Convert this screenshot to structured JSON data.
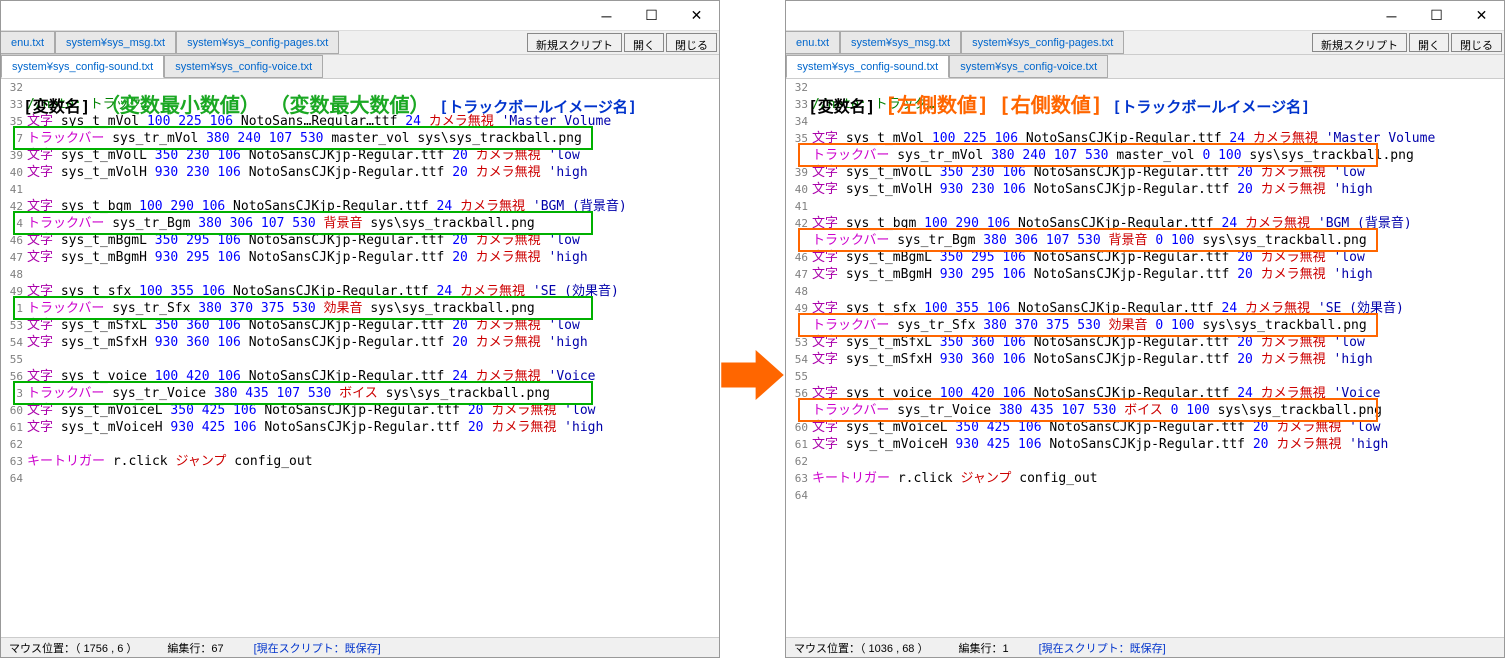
{
  "titlebar": {
    "min": "─",
    "max": "☐",
    "close": "✕"
  },
  "tabs_row1": [
    {
      "label": "enu.txt",
      "partial": true
    },
    {
      "label": "system¥sys_msg.txt",
      "partial": false
    },
    {
      "label": "system¥sys_config-pages.txt",
      "partial": false
    }
  ],
  "tabs_row2": [
    {
      "label": "system¥sys_config-sound.txt",
      "active": true
    },
    {
      "label": "system¥sys_config-voice.txt",
      "active": false
    }
  ],
  "actions": {
    "new_script": "新規スクリプト",
    "open": "開く",
    "close": "閉じる"
  },
  "annotations_left": {
    "var_name": "[変数名]",
    "min_val": "（変数最小数値）",
    "max_val": "（変数最大数値）",
    "trackball": "[トラックボールイメージ名]"
  },
  "annotations_right": {
    "var_name": "[変数名]",
    "left_val": "[左側数値]",
    "right_val": "[右側数値]",
    "trackball": "[トラックボールイメージ名]"
  },
  "lines_left": [
    {
      "no": "32",
      "html": ""
    },
    {
      "no": "33",
      "html": "<span class='c-comment'>//note: トラック…</span>"
    },
    {
      "no": "35",
      "html": "<span class='c-keyword2'>文字</span> <span class='c-black'>sys_t_mVol</span> <span class='c-number'>100 225 106</span>  <span class='c-black'>NotoSans…Regular…ttf</span> <span class='c-number'>24</span> <span class='c-red'>カメラ無視</span> <span class='c-string'>'Master Volume</span>"
    },
    {
      "no": "",
      "html": ""
    },
    {
      "no": "7",
      "html": "<span class='c-keyword'>トラックバー</span> <span class='c-black'>sys_tr_mVol</span> <span class='c-number'>380 240 107 530</span> <span class='c-black'>master_vol sys\\sys_trackball.png</span>",
      "box": "green"
    },
    {
      "no": "",
      "html": ""
    },
    {
      "no": "39",
      "html": "<span class='c-keyword2'>文字</span> <span class='c-black'>sys_t_mVolL</span> <span class='c-number'>350 230 106</span>  <span class='c-black'>NotoSansCJKjp-Regular.ttf</span> <span class='c-number'>20</span> <span class='c-red'>カメラ無視</span> <span class='c-string'>'low</span>"
    },
    {
      "no": "40",
      "html": "<span class='c-keyword2'>文字</span> <span class='c-black'>sys_t_mVolH</span> <span class='c-number'>930 230 106</span>  <span class='c-black'>NotoSansCJKjp-Regular.ttf</span> <span class='c-number'>20</span> <span class='c-red'>カメラ無視</span> <span class='c-string'>'high</span>"
    },
    {
      "no": "41",
      "html": ""
    },
    {
      "no": "42",
      "html": "<span class='c-keyword2'>文字</span> <span class='c-black'>sys_t_bgm</span> <span class='c-number'>100 290 106</span>  <span class='c-black'>NotoSansCJKjp-Regular.ttf</span> <span class='c-number'>24</span> <span class='c-red'>カメラ無視</span> <span class='c-string'>'BGM (背景音)</span>"
    },
    {
      "no": "",
      "html": ""
    },
    {
      "no": "4",
      "html": "<span class='c-keyword'>トラックバー</span> <span class='c-black'>sys_tr_Bgm</span> <span class='c-number'>380 306 107 530</span> <span class='c-red'>背景音</span> <span class='c-black'>sys\\sys_trackball.png</span>",
      "box": "green"
    },
    {
      "no": "",
      "html": ""
    },
    {
      "no": "46",
      "html": "<span class='c-keyword2'>文字</span> <span class='c-black'>sys_t_mBgmL</span> <span class='c-number'>350 295 106</span>  <span class='c-black'>NotoSansCJKjp-Regular.ttf</span> <span class='c-number'>20</span> <span class='c-red'>カメラ無視</span> <span class='c-string'>'low</span>"
    },
    {
      "no": "47",
      "html": "<span class='c-keyword2'>文字</span> <span class='c-black'>sys_t_mBgmH</span> <span class='c-number'>930 295 106</span>  <span class='c-black'>NotoSansCJKjp-Regular.ttf</span> <span class='c-number'>20</span> <span class='c-red'>カメラ無視</span> <span class='c-string'>'high</span>"
    },
    {
      "no": "48",
      "html": ""
    },
    {
      "no": "49",
      "html": "<span class='c-keyword2'>文字</span> <span class='c-black'>sys_t_sfx</span> <span class='c-number'>100 355 106</span>  <span class='c-black'>NotoSansCJKjp-Regular.ttf</span> <span class='c-number'>24</span> <span class='c-red'>カメラ無視</span> <span class='c-string'>'SE (効果音)</span>"
    },
    {
      "no": "",
      "html": ""
    },
    {
      "no": "1",
      "html": "<span class='c-keyword'>トラックバー</span> <span class='c-black'>sys_tr_Sfx</span> <span class='c-number'>380 370 375 530</span> <span class='c-red'>効果音</span> <span class='c-black'>sys\\sys_trackball.png</span>",
      "box": "green"
    },
    {
      "no": "",
      "html": ""
    },
    {
      "no": "53",
      "html": "<span class='c-keyword2'>文字</span> <span class='c-black'>sys_t_mSfxL</span> <span class='c-number'>350 360 106</span>  <span class='c-black'>NotoSansCJKjp-Regular.ttf</span> <span class='c-number'>20</span> <span class='c-red'>カメラ無視</span> <span class='c-string'>'low</span>"
    },
    {
      "no": "54",
      "html": "<span class='c-keyword2'>文字</span> <span class='c-black'>sys_t_mSfxH</span> <span class='c-number'>930 360 106</span>  <span class='c-black'>NotoSansCJKjp-Regular.ttf</span> <span class='c-number'>20</span> <span class='c-red'>カメラ無視</span> <span class='c-string'>'high</span>"
    },
    {
      "no": "55",
      "html": ""
    },
    {
      "no": "56",
      "html": "<span class='c-keyword2'>文字</span> <span class='c-black'>sys_t_voice</span> <span class='c-number'>100 420 106</span>  <span class='c-black'>NotoSansCJKjp-Regular.ttf</span> <span class='c-number'>24</span> <span class='c-red'>カメラ無視</span> <span class='c-string'>'Voice</span>"
    },
    {
      "no": "",
      "html": ""
    },
    {
      "no": "3",
      "html": "<span class='c-keyword'>トラックバー</span> <span class='c-black'>sys_tr_Voice</span> <span class='c-number'>380 435 107 530</span> <span class='c-red'>ボイス</span> <span class='c-black'>sys\\sys_trackball.png</span>",
      "box": "green"
    },
    {
      "no": "",
      "html": ""
    },
    {
      "no": "60",
      "html": "<span class='c-keyword2'>文字</span> <span class='c-black'>sys_t_mVoiceL</span> <span class='c-number'>350 425 106</span>  <span class='c-black'>NotoSansCJKjp-Regular.ttf</span> <span class='c-number'>20</span> <span class='c-red'>カメラ無視</span> <span class='c-string'>'low</span>"
    },
    {
      "no": "61",
      "html": "<span class='c-keyword2'>文字</span> <span class='c-black'>sys_t_mVoiceH</span> <span class='c-number'>930 425 106</span>  <span class='c-black'>NotoSansCJKjp-Regular.ttf</span> <span class='c-number'>20</span> <span class='c-red'>カメラ無視</span> <span class='c-string'>'high</span>"
    },
    {
      "no": "62",
      "html": ""
    },
    {
      "no": "63",
      "html": "<span class='c-keyword'>キートリガー</span> <span class='c-black'>r.click</span> <span class='c-red'>ジャンプ</span> <span class='c-black'>config_out</span>"
    },
    {
      "no": "64",
      "html": ""
    }
  ],
  "lines_right": [
    {
      "no": "32",
      "html": ""
    },
    {
      "no": "33",
      "html": "<span class='c-comment'>//note: トラック…</span>"
    },
    {
      "no": "34",
      "html": ""
    },
    {
      "no": "35",
      "html": "<span class='c-keyword2'>文字</span> <span class='c-black'>sys_t_mVol</span> <span class='c-number'>100 225 106</span>  <span class='c-black'>NotoSansCJKjp-Regular.ttf</span> <span class='c-number'>24</span> <span class='c-red'>カメラ無視</span> <span class='c-string'>'Master Volume</span>"
    },
    {
      "no": "",
      "html": ""
    },
    {
      "no": "",
      "html": "<span class='c-keyword'>トラックバー</span> <span class='c-black'>sys_tr_mVol</span> <span class='c-number'>380 240 107 530</span> <span class='c-black'>master_vol</span> <span class='c-number'>0 100</span> <span class='c-black'>sys\\sys_trackball.png</span>",
      "box": "orange"
    },
    {
      "no": "",
      "html": ""
    },
    {
      "no": "39",
      "html": "<span class='c-keyword2'>文字</span> <span class='c-black'>sys_t_mVolL</span> <span class='c-number'>350 230 106</span>  <span class='c-black'>NotoSansCJKjp-Regular.ttf</span> <span class='c-number'>20</span> <span class='c-red'>カメラ無視</span> <span class='c-string'>'low</span>"
    },
    {
      "no": "40",
      "html": "<span class='c-keyword2'>文字</span> <span class='c-black'>sys_t_mVolH</span> <span class='c-number'>930 230 106</span>  <span class='c-black'>NotoSansCJKjp-Regular.ttf</span> <span class='c-number'>20</span> <span class='c-red'>カメラ無視</span> <span class='c-string'>'high</span>"
    },
    {
      "no": "41",
      "html": ""
    },
    {
      "no": "42",
      "html": "<span class='c-keyword2'>文字</span> <span class='c-black'>sys_t_bgm</span> <span class='c-number'>100 290 106</span>  <span class='c-black'>NotoSansCJKjp-Regular.ttf</span> <span class='c-number'>24</span> <span class='c-red'>カメラ無視</span> <span class='c-string'>'BGM (背景音)</span>"
    },
    {
      "no": "",
      "html": ""
    },
    {
      "no": "",
      "html": "<span class='c-keyword'>トラックバー</span> <span class='c-black'>sys_tr_Bgm</span> <span class='c-number'>380 306 107 530</span> <span class='c-red'>背景音</span> <span class='c-number'>0 100</span> <span class='c-black'>sys\\sys_trackball.png</span>",
      "box": "orange"
    },
    {
      "no": "",
      "html": ""
    },
    {
      "no": "46",
      "html": "<span class='c-keyword2'>文字</span> <span class='c-black'>sys_t_mBgmL</span> <span class='c-number'>350 295 106</span>  <span class='c-black'>NotoSansCJKjp-Regular.ttf</span> <span class='c-number'>20</span> <span class='c-red'>カメラ無視</span> <span class='c-string'>'low</span>"
    },
    {
      "no": "47",
      "html": "<span class='c-keyword2'>文字</span> <span class='c-black'>sys_t_mBgmH</span> <span class='c-number'>930 295 106</span>  <span class='c-black'>NotoSansCJKjp-Regular.ttf</span> <span class='c-number'>20</span> <span class='c-red'>カメラ無視</span> <span class='c-string'>'high</span>"
    },
    {
      "no": "48",
      "html": ""
    },
    {
      "no": "49",
      "html": "<span class='c-keyword2'>文字</span> <span class='c-black'>sys_t_sfx</span> <span class='c-number'>100 355 106</span>  <span class='c-black'>NotoSansCJKjp-Regular.ttf</span> <span class='c-number'>24</span> <span class='c-red'>カメラ無視</span> <span class='c-string'>'SE (効果音)</span>"
    },
    {
      "no": "",
      "html": ""
    },
    {
      "no": "",
      "html": "<span class='c-keyword'>トラックバー</span> <span class='c-black'>sys_tr_Sfx</span> <span class='c-number'>380 370 375 530</span> <span class='c-red'>効果音</span> <span class='c-number'>0 100</span> <span class='c-black'>sys\\sys_trackball.png</span>",
      "box": "orange"
    },
    {
      "no": "",
      "html": ""
    },
    {
      "no": "53",
      "html": "<span class='c-keyword2'>文字</span> <span class='c-black'>sys_t_mSfxL</span> <span class='c-number'>350 360 106</span>  <span class='c-black'>NotoSansCJKjp-Regular.ttf</span> <span class='c-number'>20</span> <span class='c-red'>カメラ無視</span> <span class='c-string'>'low</span>"
    },
    {
      "no": "54",
      "html": "<span class='c-keyword2'>文字</span> <span class='c-black'>sys_t_mSfxH</span> <span class='c-number'>930 360 106</span>  <span class='c-black'>NotoSansCJKjp-Regular.ttf</span> <span class='c-number'>20</span> <span class='c-red'>カメラ無視</span> <span class='c-string'>'high</span>"
    },
    {
      "no": "55",
      "html": ""
    },
    {
      "no": "56",
      "html": "<span class='c-keyword2'>文字</span> <span class='c-black'>sys_t_voice</span> <span class='c-number'>100 420 106</span>  <span class='c-black'>NotoSansCJKjp-Regular.ttf</span> <span class='c-number'>24</span> <span class='c-red'>カメラ無視</span> <span class='c-string'>'Voice</span>"
    },
    {
      "no": "",
      "html": ""
    },
    {
      "no": "",
      "html": "<span class='c-keyword'>トラックバー</span> <span class='c-black'>sys_tr_Voice</span> <span class='c-number'>380 435 107 530</span> <span class='c-red'>ボイス</span> <span class='c-number'>0 100</span> <span class='c-black'>sys\\sys_trackball.png</span>",
      "box": "orange"
    },
    {
      "no": "",
      "html": ""
    },
    {
      "no": "60",
      "html": "<span class='c-keyword2'>文字</span> <span class='c-black'>sys_t_mVoiceL</span> <span class='c-number'>350 425 106</span>  <span class='c-black'>NotoSansCJKjp-Regular.ttf</span> <span class='c-number'>20</span> <span class='c-red'>カメラ無視</span> <span class='c-string'>'low</span>"
    },
    {
      "no": "61",
      "html": "<span class='c-keyword2'>文字</span> <span class='c-black'>sys_t_mVoiceH</span> <span class='c-number'>930 425 106</span>  <span class='c-black'>NotoSansCJKjp-Regular.ttf</span> <span class='c-number'>20</span> <span class='c-red'>カメラ無視</span> <span class='c-string'>'high</span>"
    },
    {
      "no": "62",
      "html": ""
    },
    {
      "no": "63",
      "html": "<span class='c-keyword'>キートリガー</span> <span class='c-black'>r.click</span> <span class='c-red'>ジャンプ</span> <span class='c-black'>config_out</span>"
    },
    {
      "no": "64",
      "html": ""
    }
  ],
  "status_left": {
    "mouse": "マウス位置：（ 1756 , 6 ）",
    "edit": "編集行：67",
    "script": "[現在スクリプト：既保存]"
  },
  "status_right": {
    "mouse": "マウス位置：（ 1036 , 68 ）",
    "edit": "編集行：1",
    "script": "[現在スクリプト：既保存]"
  }
}
